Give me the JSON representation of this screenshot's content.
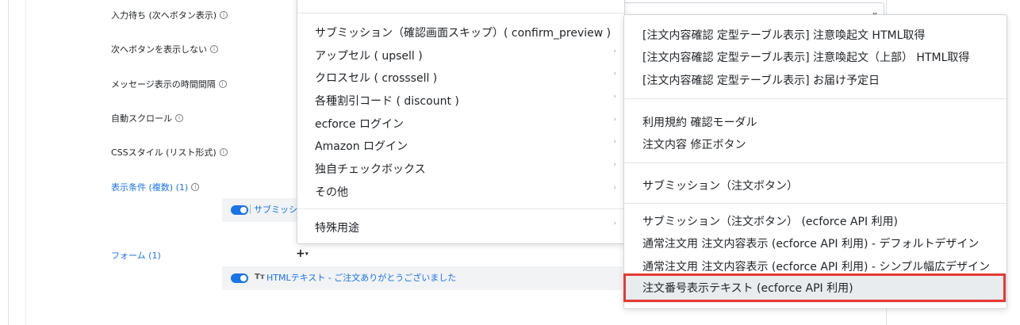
{
  "settings": {
    "input_wait": "入力待ち (次へボタン表示)",
    "hide_next": "次へボタンを表示しない",
    "message_interval": "メッセージ表示の時間間隔",
    "auto_scroll": "自動スクロール",
    "css_style": "CSSスタイル (リスト形式)",
    "display_conditions": "表示条件 (複数) (1)",
    "form": "フォーム (1)",
    "info_glyph": "i"
  },
  "condition_row": {
    "text": "サブミッショ"
  },
  "form_row": {
    "type_icon": "Tт",
    "text": "HTMLテキスト - ご注文ありがとうございました"
  },
  "add_button": {
    "plus": "+",
    "caret": "▾"
  },
  "select": {
    "chevron": "⌄"
  },
  "left_menu": {
    "items": [
      {
        "label": "サブミッション（確認画面スキップ）( confirm_preview )",
        "has_submenu": false
      },
      {
        "label": "アップセル ( upsell )",
        "has_submenu": true
      },
      {
        "label": "クロスセル ( crosssell )",
        "has_submenu": true
      },
      {
        "label": "各種割引コード ( discount )",
        "has_submenu": true
      },
      {
        "label": "ecforce ログイン",
        "has_submenu": true
      },
      {
        "label": "Amazon ログイン",
        "has_submenu": true
      },
      {
        "label": "独自チェックボックス",
        "has_submenu": true
      },
      {
        "label": "その他",
        "has_submenu": true
      },
      {
        "label": "特殊用途",
        "has_submenu": true
      }
    ],
    "arrow_glyph": "›"
  },
  "right_menu": {
    "items": [
      {
        "label": "[注文内容確認 定型テーブル表示] 注意喚起文 HTML取得"
      },
      {
        "label": "[注文内容確認 定型テーブル表示] 注意喚起文（上部） HTML取得"
      },
      {
        "label": "[注文内容確認 定型テーブル表示] お届け予定日"
      },
      {
        "label": "利用規約 確認モーダル"
      },
      {
        "label": "注文内容 修正ボタン"
      },
      {
        "label": "サブミッション（注文ボタン）"
      },
      {
        "label": "サブミッション（注文ボタン） (ecforce API 利用)"
      },
      {
        "label": "通常注文用 注文内容表示 (ecforce API 利用) - デフォルトデザイン"
      },
      {
        "label": "通常注文用 注文内容表示 (ecforce API 利用) - シンプル幅広デザイン"
      },
      {
        "label": "注文番号表示テキスト (ecforce API 利用)"
      }
    ]
  },
  "colors": {
    "link": "#1a73e8",
    "highlight": "#e53935",
    "active_bg": "#e9ecef"
  }
}
